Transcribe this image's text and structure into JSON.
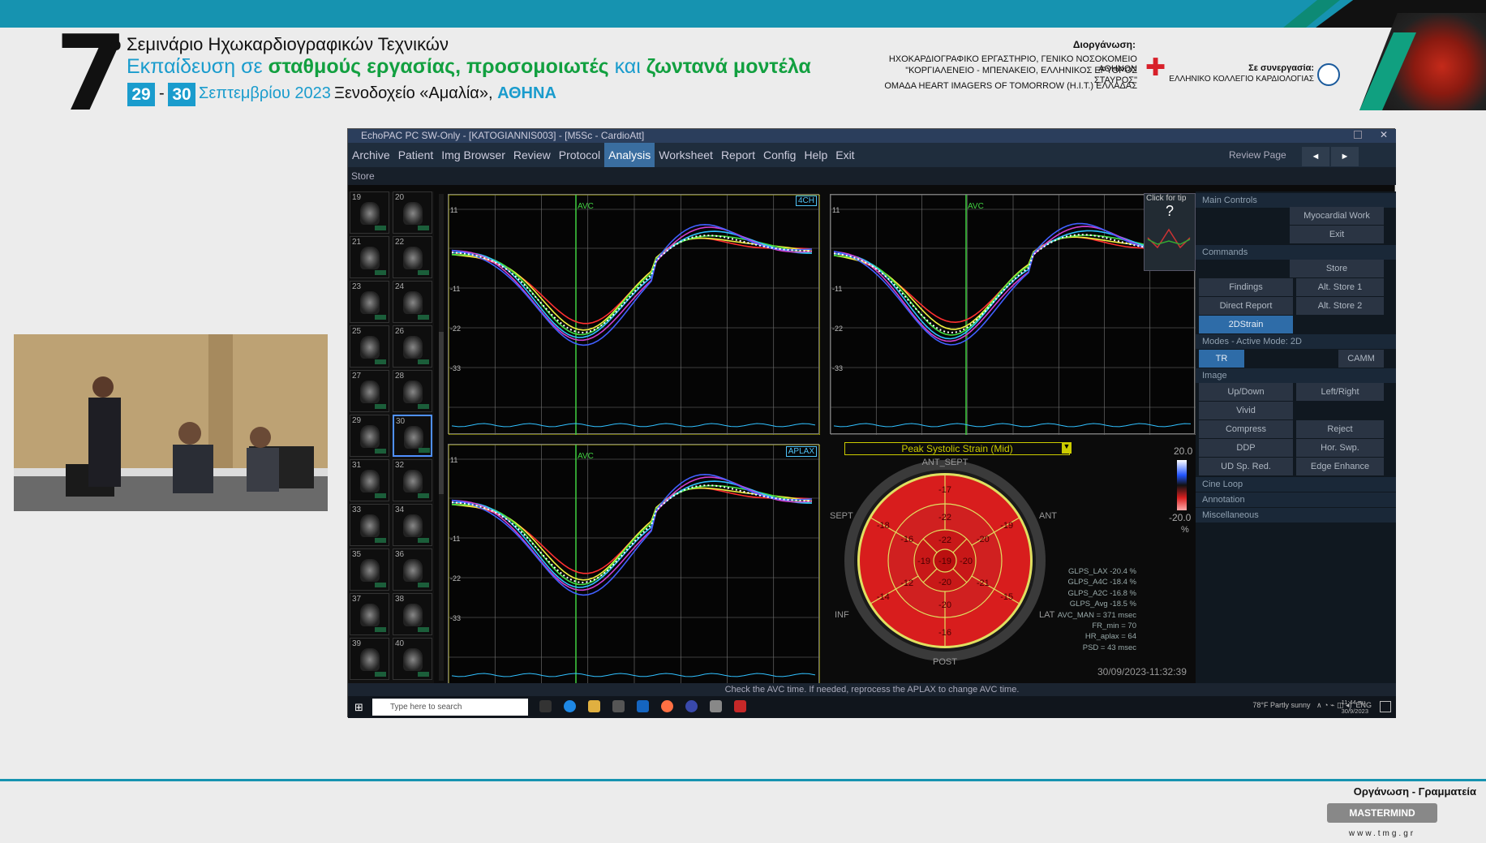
{
  "header": {
    "number": "7",
    "superscript": "ο",
    "title_line1": "Σεμινάριο Ηχωκαρδιογραφικών Τεχνικών",
    "title_line2_a": "Εκπαίδευση σε ",
    "title_line2_b": "σταθμούς εργασίας, προσομοιωτές",
    "title_line2_c": " και ",
    "title_line2_d": "ζωντανά μοντέλα",
    "date_day1": "29",
    "date_dash": "-",
    "date_day2": "30",
    "date_text": "Σεπτεμβρίου 2023",
    "venue": "Ξενοδοχείο «Αμαλία», ",
    "venue_city": "ΑΘΗΝΑ",
    "organizer_label": "Διοργάνωση:",
    "organizer_line1": "ΗΧΟΚΑΡΔΙΟΓΡΑΦΙΚΟ ΕΡΓΑΣΤΗΡΙΟ, ΓΕΝΙΚΟ ΝΟΣΟΚΟΜΕΙΟ ΑΘΗΝΩΝ",
    "organizer_line2": "\"ΚΟΡΓΙΑΛΕΝΕΙΟ - ΜΠΕΝΑΚΕΙΟ, ΕΛΛΗΝΙΚΟΣ ΕΡΥΘΡΟΣ ΣΤΑΥΡΟΣ\"",
    "organizer_line3": "ΟΜΑΔΑ HEART IMAGERS OF TOMORROW (H.I.T.) ΕΛΛΑΔΑΣ",
    "coop_label": "Σε συνεργασία:",
    "coop_name": "ΕΛΛΗΝΙΚΟ ΚΟΛΛΕΓΙΟ ΚΑΡΔΙΟΛΟΓΙΑΣ"
  },
  "footer": {
    "org_label": "Οργάνωση - Γραμματεία",
    "logo_text": "MASTERMIND",
    "url": "www.tmg.gr"
  },
  "app": {
    "window_title": "EchoPAC PC SW-Only - [KATOGIANNIS003] - [M5Sc - CardioAtt]",
    "menu": [
      "Archive",
      "Patient",
      "Img Browser",
      "Review",
      "Protocol",
      "Analysis",
      "Worksheet",
      "Report",
      "Config",
      "Help",
      "Exit"
    ],
    "active_menu": "Analysis",
    "store_tab": "Store",
    "review_page_label": "Review Page",
    "nav_prev": "◄",
    "nav_next": "►",
    "thumb_numbers": [
      "19",
      "20",
      "21",
      "22",
      "23",
      "24",
      "25",
      "26",
      "27",
      "28",
      "29",
      "30",
      "31",
      "32",
      "33",
      "34",
      "35",
      "36",
      "37",
      "38",
      "39",
      "40"
    ],
    "plots": {
      "p1_label": "4CH",
      "p3_label": "APLAX",
      "avc": "AVC",
      "y_ticks": [
        "11",
        "-11",
        "-22",
        "-33"
      ],
      "help_tip": "Click for tip",
      "help_q": "?"
    },
    "bullseye": {
      "title": "Peak Systolic Strain (Mid)",
      "scale_max": "20.0",
      "scale_min": "-20.0",
      "scale_unit": "%",
      "labels": {
        "ant_sept": "ANT_SEPT",
        "ant": "ANT",
        "sept": "SEPT",
        "inf": "INF",
        "lat": "LAT",
        "post": "POST"
      },
      "segments": [
        "-17",
        "-19",
        "-15",
        "-16",
        "-14",
        "-18",
        "-22",
        "-20",
        "-21",
        "-20",
        "-12",
        "-16",
        "-22",
        "-20",
        "-20",
        "-19",
        "-19"
      ]
    },
    "stats": [
      "GLPS_LAX -20.4 %",
      "GLPS_A4C -18.4 %",
      "GLPS_A2C -16.8 %",
      "GLPS_Avg -18.5 %",
      "AVC_MAN = 371 msec",
      "FR_min = 70",
      "HR_aplax = 64",
      "PSD = 43 msec"
    ],
    "timestamp": "30/09/2023-11:32:39",
    "right_panel": {
      "main_controls": "Main Controls",
      "myocardial_work": "Myocardial Work",
      "exit": "Exit",
      "commands": "Commands",
      "store": "Store",
      "findings": "Findings",
      "alt_store1": "Alt. Store 1",
      "direct_report": "Direct Report",
      "alt_store2": "Alt. Store 2",
      "strain2d": "2DStrain",
      "modes": "Modes - Active Mode: 2D",
      "tr": "TR",
      "camm": "CAMM",
      "image": "Image",
      "up_down": "Up/Down",
      "left_right": "Left/Right",
      "vivid": "Vivid",
      "compress": "Compress",
      "reject": "Reject",
      "ddp": "DDP",
      "hor_swp": "Hor. Swp.",
      "ud_sp_red": "UD Sp. Red.",
      "edge_enhance": "Edge Enhance",
      "cine_loop": "Cine Loop",
      "annotation": "Annotation",
      "misc": "Miscellaneous"
    },
    "status_message": "Check the AVC time. If needed, reprocess the APLAX to change AVC time.",
    "taskbar": {
      "search_placeholder": "Type here to search",
      "weather": "78°F  Partly sunny",
      "lang": "ENG",
      "time": "11:44 πμ",
      "date": "30/9/2023"
    }
  },
  "colors": {
    "accent": "#1693b0",
    "title_blue": "#1a9ccd",
    "title_green": "#12a040",
    "bullseye_red": "#d81d1d"
  }
}
